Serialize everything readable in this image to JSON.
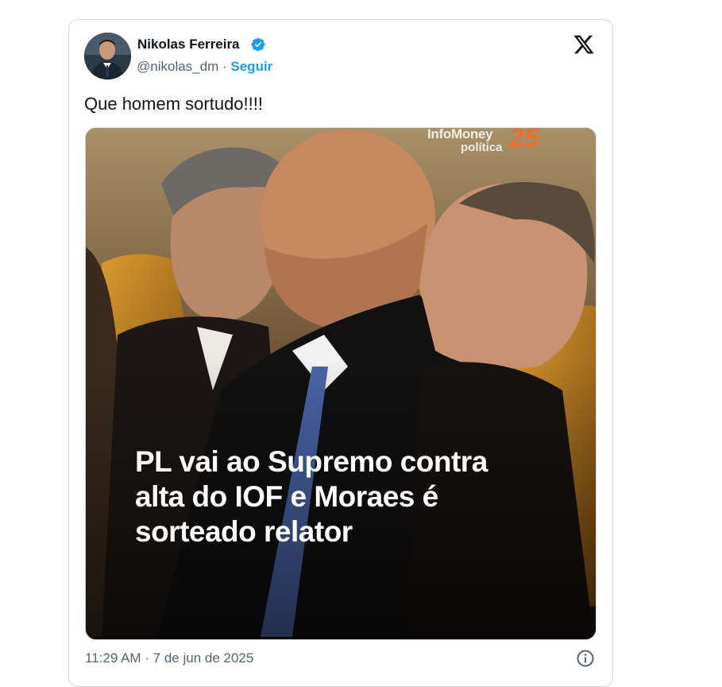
{
  "author": {
    "name": "Nikolas Ferreira",
    "handle": "@nikolas_dm",
    "separator": "·",
    "follow_label": "Seguir",
    "verified": true
  },
  "icons": {
    "verified": "verified-badge-icon",
    "logo": "x-logo-icon",
    "info": "info-icon"
  },
  "tweet": {
    "text": "Que homem sortudo!!!!"
  },
  "media": {
    "brand_name": "InfoMoney",
    "brand_number": "25",
    "brand_sub": "política",
    "headline_lines": [
      "PL vai ao Supremo contra",
      "alta do IOF e Moraes é",
      "sorteado relator"
    ]
  },
  "footer": {
    "timestamp": "11:29 AM · 7 de jun de 2025"
  },
  "colors": {
    "accent": "#1d9bf0",
    "text": "#0f1419",
    "muted": "#536471",
    "brand_orange": "#e8712b"
  }
}
